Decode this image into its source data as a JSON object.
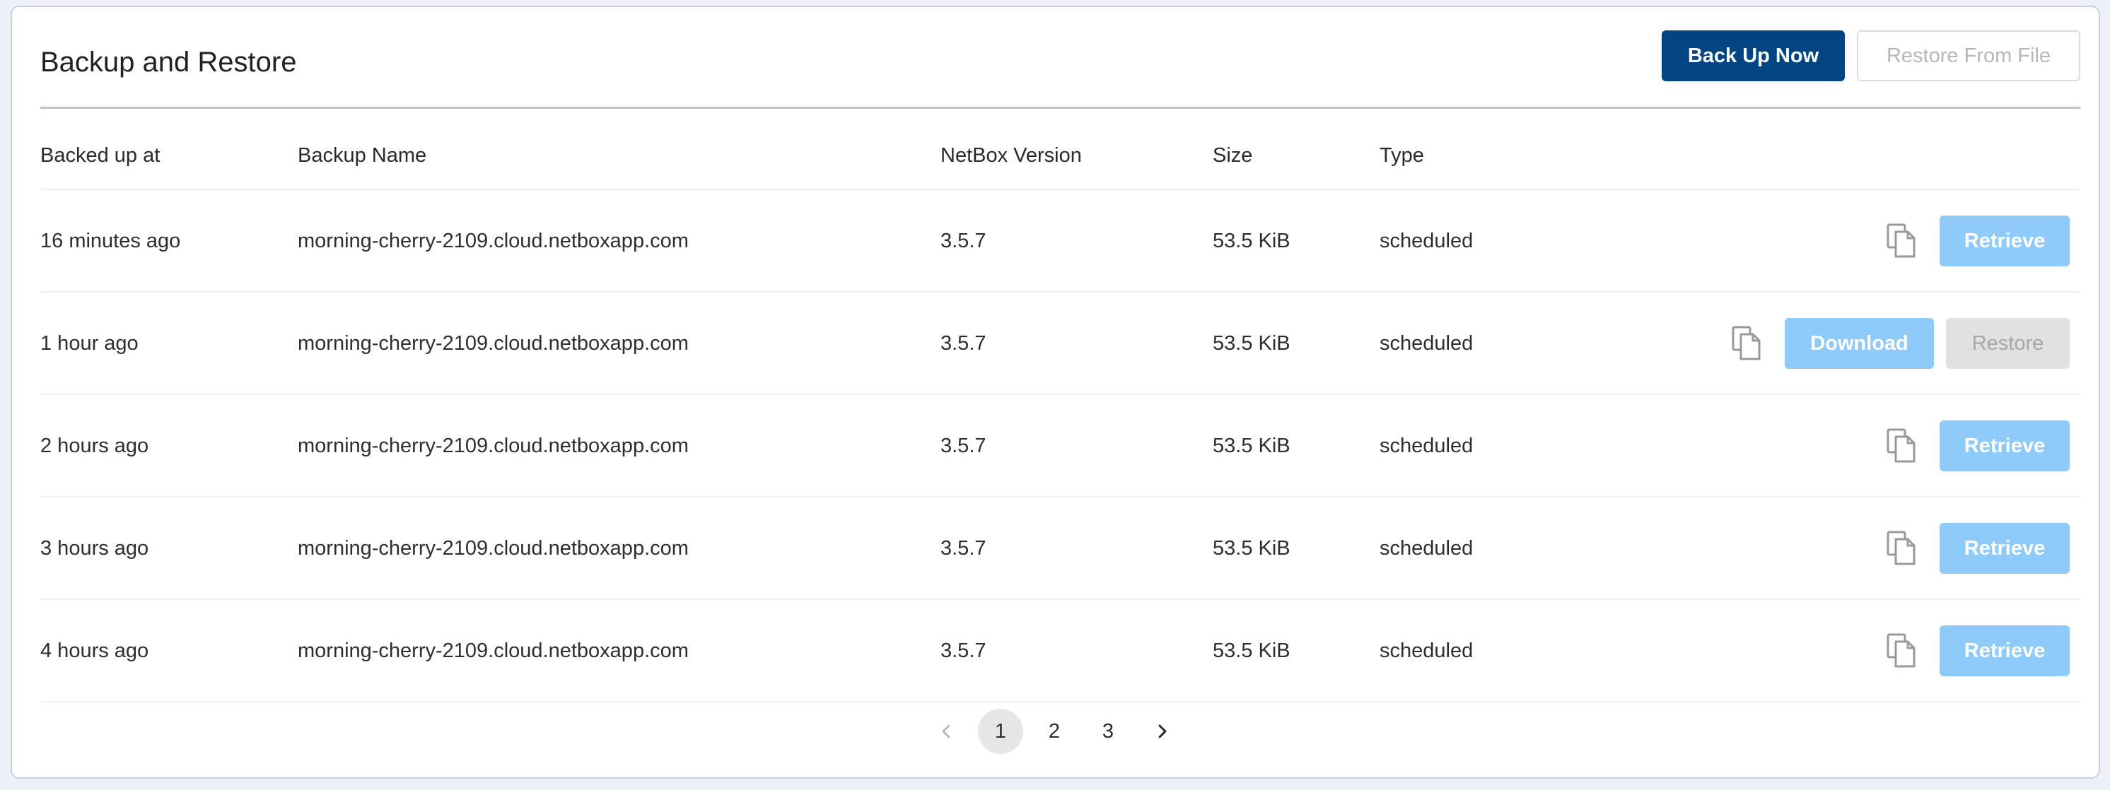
{
  "page": {
    "title": "Backup and Restore",
    "actions": {
      "backup_now": "Back Up Now",
      "restore_from_file": "Restore From File"
    }
  },
  "table": {
    "columns": [
      "Backed up at",
      "Backup Name",
      "NetBox Version",
      "Size",
      "Type"
    ],
    "rows": [
      {
        "backed_up_at": "16 minutes ago",
        "name": "morning-cherry-2109.cloud.netboxapp.com",
        "version": "3.5.7",
        "size": "53.5 KiB",
        "type": "scheduled",
        "actions": [
          "Retrieve"
        ]
      },
      {
        "backed_up_at": "1 hour ago",
        "name": "morning-cherry-2109.cloud.netboxapp.com",
        "version": "3.5.7",
        "size": "53.5 KiB",
        "type": "scheduled",
        "actions": [
          "Download",
          "Restore"
        ]
      },
      {
        "backed_up_at": "2 hours ago",
        "name": "morning-cherry-2109.cloud.netboxapp.com",
        "version": "3.5.7",
        "size": "53.5 KiB",
        "type": "scheduled",
        "actions": [
          "Retrieve"
        ]
      },
      {
        "backed_up_at": "3 hours ago",
        "name": "morning-cherry-2109.cloud.netboxapp.com",
        "version": "3.5.7",
        "size": "53.5 KiB",
        "type": "scheduled",
        "actions": [
          "Retrieve"
        ]
      },
      {
        "backed_up_at": "4 hours ago",
        "name": "morning-cherry-2109.cloud.netboxapp.com",
        "version": "3.5.7",
        "size": "53.5 KiB",
        "type": "scheduled",
        "actions": [
          "Retrieve"
        ]
      }
    ]
  },
  "pagination": {
    "prev_icon": "chevron-left-icon",
    "pages": [
      "1",
      "2",
      "3"
    ],
    "current": "1",
    "next_icon": "chevron-right-icon"
  },
  "colors": {
    "primary": "#034582",
    "retrieve": "#8ecbfa",
    "disabled_bg": "#e1e1e1"
  }
}
